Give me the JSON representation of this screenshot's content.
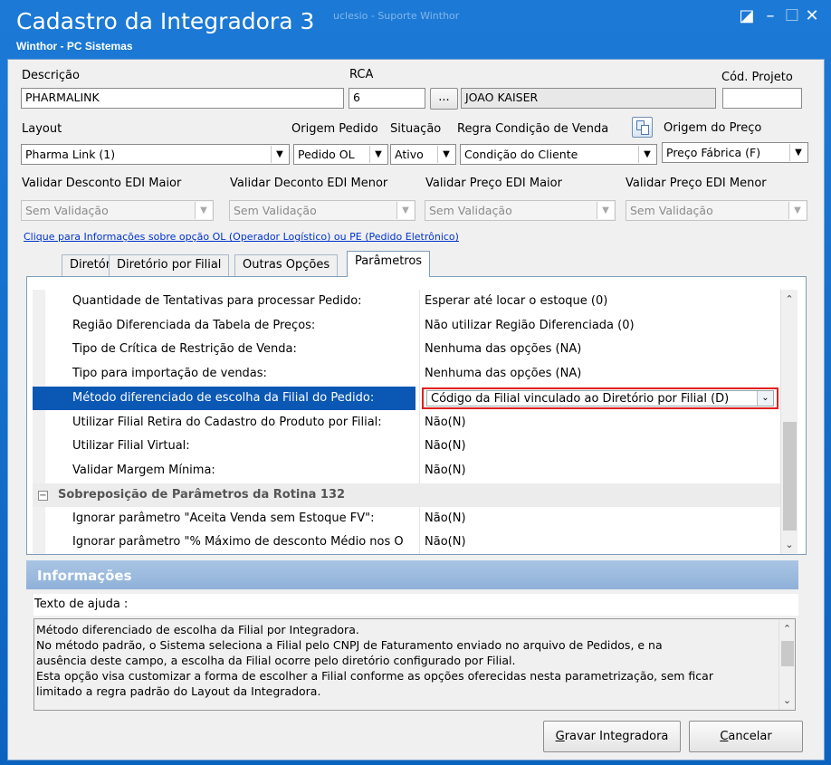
{
  "window": {
    "title": "Cadastro da Integradora 3",
    "ghost_title": "uclesio - Suporte Winthor",
    "subtitle": "Winthor - PC Sistemas",
    "restore_glyph": "◪",
    "minimize_glyph": "–",
    "maximize_glyph": "☐",
    "close_glyph": "✕"
  },
  "form": {
    "descricao_label": "Descrição",
    "descricao_value": "PHARMALINK",
    "rca_label": "RCA",
    "rca_value": "6",
    "rca_lookup_label": "...",
    "rca_name": "JOAO KAISER",
    "cod_projeto_label": "Cód. Projeto",
    "cod_projeto_value": "",
    "layout_label": "Layout",
    "layout_value": "Pharma Link (1)",
    "origem_pedido_label": "Origem Pedido",
    "origem_pedido_value": "Pedido OL",
    "situacao_label": "Situação",
    "situacao_value": "Ativo",
    "regra_label": "Regra Condição de Venda",
    "regra_value": "Condição do Cliente",
    "origem_preco_label": "Origem do Preço",
    "origem_preco_value": "Preço Fábrica (F)",
    "validar_desc_maior_label": "Validar Desconto EDI Maior",
    "validar_desc_maior_value": "Sem Validação",
    "validar_desc_menor_label": "Validar Deconto EDI Menor",
    "validar_desc_menor_value": "Sem Validação",
    "validar_preco_maior_label": "Validar Preço EDI Maior",
    "validar_preco_maior_value": "Sem Validação",
    "validar_preco_menor_label": "Validar Preço EDI Menor",
    "validar_preco_menor_value": "Sem Validação",
    "info_link": "Clique para Informações sobre opção OL (Operador Logístico) ou PE (Pedido Eletrônico)"
  },
  "tabs": [
    "Diretório",
    "Diretório por Filial",
    "Outras Opções",
    "Parâmetros"
  ],
  "params": {
    "rows": [
      {
        "k": "Quantidade de Tentativas para processar Pedido:",
        "v": "Esperar até locar o estoque (0)"
      },
      {
        "k": "Região Diferenciada da Tabela de Preços:",
        "v": "Não utilizar Região Diferenciada (0)"
      },
      {
        "k": "Tipo de Crítica de Restrição de Venda:",
        "v": "Nenhuma das opções (NA)"
      },
      {
        "k": "Tipo para importação de vendas:",
        "v": "Nenhuma das opções (NA)"
      },
      {
        "k": "Método diferenciado de escolha da Filial do Pedido:",
        "v": "Código da Filial vinculado ao Diretório por Filial (D)"
      },
      {
        "k": "Utilizar Filial Retira do Cadastro do Produto por Filial:",
        "v": "Não(N)"
      },
      {
        "k": "Utilizar Filial Virtual:",
        "v": "Não(N)"
      },
      {
        "k": "Validar Margem Mínima:",
        "v": "Não(N)"
      },
      {
        "k": "Ignorar parâmetro \"Aceita Venda sem Estoque FV\":",
        "v": "Não(N)"
      },
      {
        "k": "Ignorar parâmetro \"% Máximo de desconto Médio nos O",
        "v": "Não(N)"
      }
    ],
    "section_title": "Sobreposição de Parâmetros da Rotina 132",
    "section_toggle": "−"
  },
  "info": {
    "header": "Informações",
    "help_label": "Texto de ajuda :",
    "help_lines": [
      "Método diferenciado de escolha da Filial por Integradora.",
      "No método padrão, o Sistema seleciona a Filial pelo CNPJ de Faturamento enviado no arquivo de Pedidos, e na",
      "ausência deste campo, a escolha da Filial ocorre pelo diretório configurado por Filial.",
      "Esta opção visa customizar a forma de escolher a Filial conforme as opções oferecidas nesta parametrização, sem ficar",
      "limitado a regra padrão do Layout da Integradora."
    ]
  },
  "buttons": {
    "gravar_accel": "G",
    "gravar_rest": "ravar Integradora",
    "cancelar_accel": "C",
    "cancelar_rest": "ancelar"
  },
  "glyphs": {
    "dropdown": "▼",
    "chevron_down": "⌄",
    "scroll_up": "⌃",
    "scroll_down": "⌄"
  },
  "colors": {
    "selection": "#0a57b4",
    "highlight_border": "#e02020",
    "title_bar": "#0e69c6"
  }
}
